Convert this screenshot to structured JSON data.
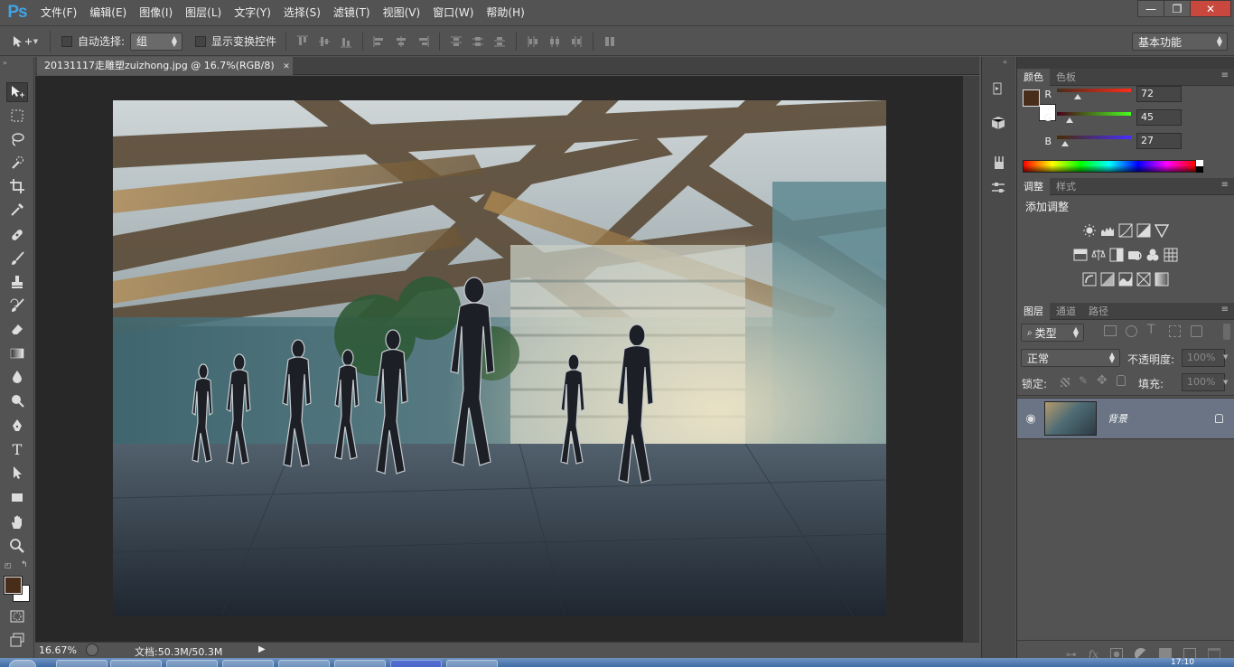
{
  "app": {
    "logo": "Ps"
  },
  "menu": [
    "文件(F)",
    "编辑(E)",
    "图像(I)",
    "图层(L)",
    "文字(Y)",
    "选择(S)",
    "滤镜(T)",
    "视图(V)",
    "窗口(W)",
    "帮助(H)"
  ],
  "window_controls": {
    "minimize": "—",
    "restore": "❐",
    "close": "✕"
  },
  "options": {
    "auto_select_label": "自动选择:",
    "auto_select_value": "组",
    "show_transform_label": "显示变换控件",
    "workspace": "基本功能"
  },
  "document": {
    "tab_title": "20131117走雕塑zuizhong.jpg @ 16.7%(RGB/8)",
    "close_icon": "✕"
  },
  "status": {
    "zoom": "16.67%",
    "doc_info": "文档:50.3M/50.3M"
  },
  "color_panel": {
    "tabs": [
      "颜色",
      "色板"
    ],
    "foreground": "#482d1b",
    "background": "#ffffff",
    "channels": [
      {
        "label": "R",
        "value": "72",
        "fraction": 0.282
      },
      {
        "label": "G",
        "value": "45",
        "fraction": 0.176
      },
      {
        "label": "B",
        "value": "27",
        "fraction": 0.106
      }
    ]
  },
  "adjustments_panel": {
    "tabs": [
      "调整",
      "样式"
    ],
    "title": "添加调整"
  },
  "layers_panel": {
    "tabs": [
      "图层",
      "通道",
      "路径"
    ],
    "filter_kind": "类型",
    "blend_mode": "正常",
    "opacity_label": "不透明度:",
    "opacity_value": "100%",
    "lock_label": "锁定:",
    "fill_label": "填充:",
    "fill_value": "100%",
    "layers": [
      {
        "name": "背景",
        "visible": true,
        "locked": true
      }
    ]
  },
  "taskbar": {
    "clock": "17:10"
  }
}
